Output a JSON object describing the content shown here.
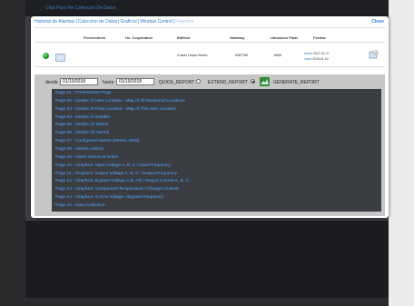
{
  "background": {
    "top_link": "Click Para Ver Coleccion De Datos"
  },
  "modal": {
    "tabs": [
      {
        "label": "Historial de Alarmas"
      },
      {
        "label": "Coleccion de Datos"
      },
      {
        "label": "Graficos"
      },
      {
        "label": "Window Control"
      },
      {
        "label": "Reportes"
      }
    ],
    "close_label": "Close"
  },
  "table": {
    "headers": [
      "Proveedores",
      "Us. Corporativo",
      "Edificio",
      "Gateway",
      "Ubicacion Final",
      "Fechas"
    ],
    "row": {
      "edificio": "Cuarto Limpio Beech",
      "gateway": "6387766",
      "ubicacion": "8955",
      "desde_label": "desde",
      "desde_value": "2017-02-27",
      "hasta_label": "hasta",
      "hasta_value": "2018-01-10"
    }
  },
  "report_form": {
    "desde_label": "desde",
    "desde_value": "01/10/2018",
    "hasta_label": "hasta",
    "hasta_value": "01/10/2018",
    "quick_label": "QUICK_REPORT",
    "extend_label": "EXTEND_REPORT",
    "generate_label": "GENERATE_REPORT",
    "selected": "EXTEND_REPORT"
  },
  "pages": [
    "Page 01 - Presentation Page",
    "Page 02 - Details of User Location - Map of All Monitored Locations",
    "Page 03 - Details of Final Location - Map of This user Location",
    "Page 04 - Details of Installer",
    "Page 05 - Details Of Status",
    "Page 06 - Details Of Alarms",
    "Page 07 - Configured Alarms (EMAIL-SMS)",
    "Page 08 - Alarms History",
    "Page 09 - Alarm Historical Notes",
    "Page 10 - Graphics: Input Voltage A, B, C / Input Frequency",
    "Page 11 - Graphics: Output Voltage A, B, C / Output Frequency",
    "Page 12 - Graphics: Bypass Voltage A,B, HZ / Output Current A, B, C",
    "Page 13 - Graphics: Component Temperature / Charger Current",
    "Page 14 - Graphics: G to N Voltage / Bypass Frequency",
    "Page 15 - Data Collection"
  ]
}
